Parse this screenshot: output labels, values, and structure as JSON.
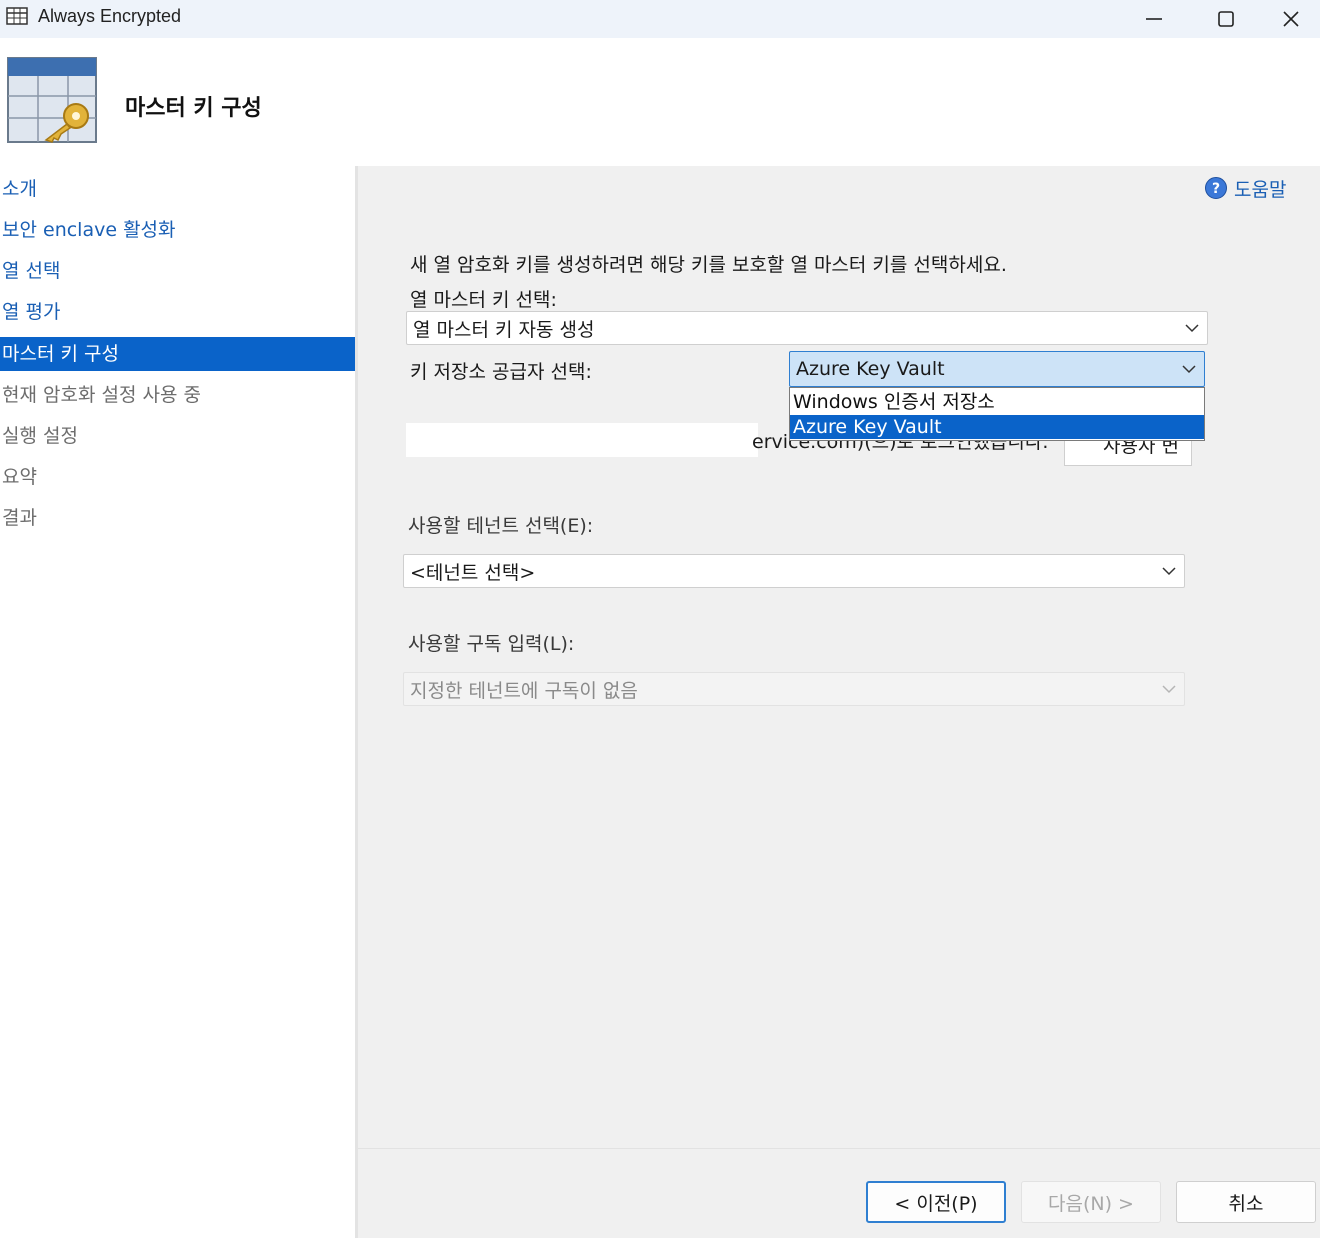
{
  "window": {
    "title": "Always Encrypted",
    "icons": {
      "app": "table-icon",
      "minimize": "minimize-icon",
      "maximize": "maximize-icon",
      "close": "close-icon"
    }
  },
  "header": {
    "title": "마스터 키 구성",
    "icon": "table-key-icon"
  },
  "sidebar": {
    "items": [
      {
        "label": "소개",
        "state": "link"
      },
      {
        "label": "보안 enclave 활성화",
        "state": "link"
      },
      {
        "label": "열 선택",
        "state": "link"
      },
      {
        "label": "열 평가",
        "state": "link"
      },
      {
        "label": "마스터 키 구성",
        "state": "selected"
      },
      {
        "label": "현재 암호화 설정 사용 중",
        "state": "disabled"
      },
      {
        "label": "실행 설정",
        "state": "disabled"
      },
      {
        "label": "요약",
        "state": "disabled"
      },
      {
        "label": "결과",
        "state": "disabled"
      }
    ]
  },
  "main": {
    "help_label": "도움말",
    "instruction": "새 열 암호화 키를 생성하려면 해당 키를 보호할 열 마스터 키를 선택하세요.",
    "cmk_label": "열 마스터 키 선택:",
    "cmk_value": "열 마스터 키 자동 생성",
    "provider_label": "키 저장소 공급자 선택:",
    "provider_value": "Azure Key Vault",
    "provider_options": [
      {
        "label": "Windows 인증서 저장소",
        "selected": false
      },
      {
        "label": "Azure Key Vault",
        "selected": true
      }
    ],
    "signin_text": "ervice.com)(으)로 로그인했습니다.",
    "user_button_label": "사용자 변",
    "tenant_label": "사용할 테넌트 선택(E):",
    "tenant_value": "<테넌트 선택>",
    "subscription_label": "사용할 구독 입력(L):",
    "subscription_value": "지정한 테넌트에 구독이 없음"
  },
  "footer": {
    "prev_label": "< 이전(P)",
    "next_label": "다음(N) >",
    "cancel_label": "취소"
  },
  "colors": {
    "accent": "#0a63c9",
    "link": "#1a5fb4",
    "dropdown_highlight": "#cde3f7"
  }
}
